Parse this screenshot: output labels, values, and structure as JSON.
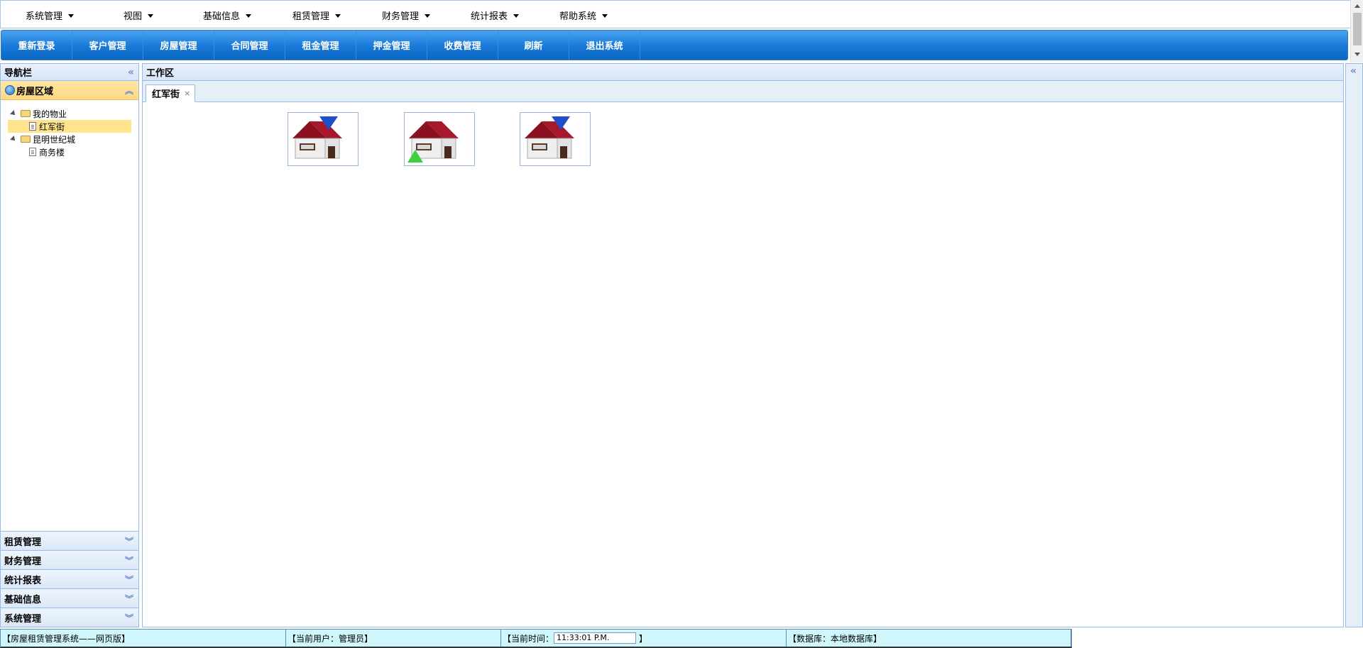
{
  "menubar": {
    "items": [
      "系统管理",
      "视图",
      "基础信息",
      "租赁管理",
      "财务管理",
      "统计报表",
      "帮助系统"
    ]
  },
  "toolbar": {
    "buttons": [
      "重新登录",
      "客户管理",
      "房屋管理",
      "合同管理",
      "租金管理",
      "押金管理",
      "收费管理",
      "刷新",
      "退出系统"
    ]
  },
  "nav": {
    "title": "导航栏",
    "collapse_icon": "double-chevron-left-icon",
    "open_section": "房屋区域",
    "tree": {
      "folder1": "我的物业",
      "folder1_child": "红军街",
      "folder2": "昆明世纪城",
      "folder2_child": "商务楼"
    },
    "sections": [
      "租赁管理",
      "财务管理",
      "统计报表",
      "基础信息",
      "系统管理"
    ]
  },
  "work": {
    "title": "工作区",
    "tab_label": "红军街",
    "tab_close": "×",
    "houses": [
      {
        "marker": "blue-triangle-top-right"
      },
      {
        "marker": "green-triangle-bottom-left"
      },
      {
        "marker": "blue-triangle-top-right"
      }
    ]
  },
  "status": {
    "system": "【房屋租赁管理系统——网页版】",
    "user": "【当前用户：管理员】",
    "time_label": "【当前时间：",
    "time_value": "11:33:01 P.M.",
    "time_end": "】",
    "db": "【数据库：本地数据库】"
  },
  "colors": {
    "toolbar_blue": "#1779d8",
    "selected_yellow": "#ffe48d",
    "status_bg": "#cff7fb"
  }
}
